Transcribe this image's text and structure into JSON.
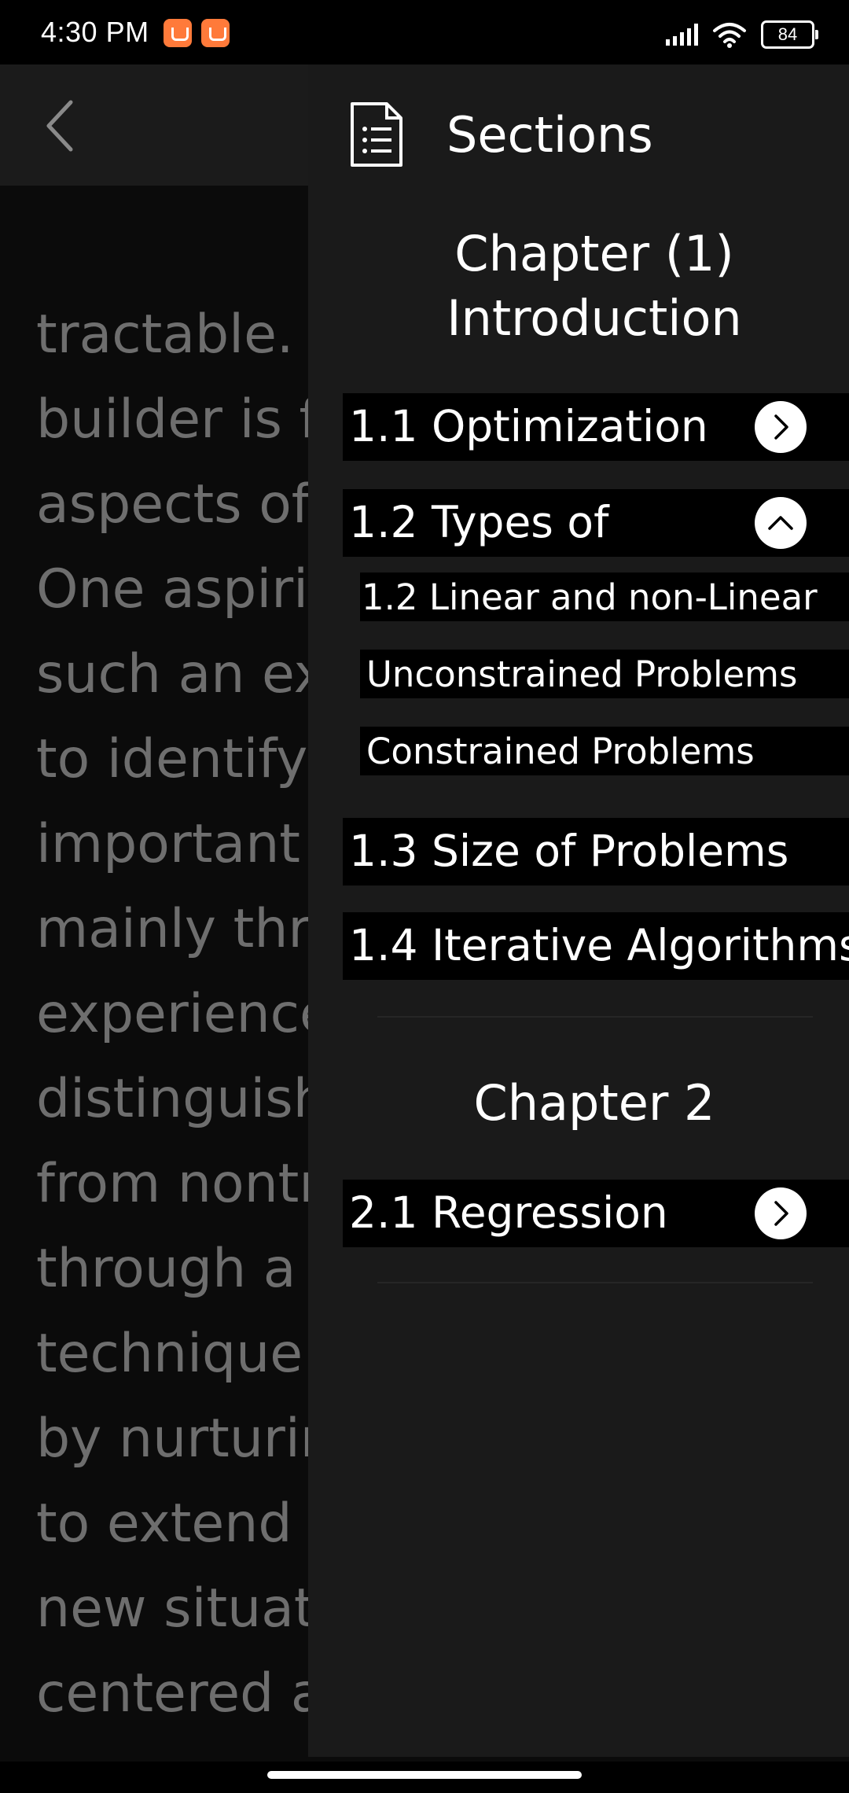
{
  "status_bar": {
    "time": "4:30 PM",
    "battery": "84",
    "icons": [
      "notification-app-icon",
      "notification-app-icon",
      "signal-icon",
      "wifi-icon",
      "battery-icon"
    ]
  },
  "reader": {
    "back_icon": "chevron-left-icon",
    "lines": [
      "tractable. T",
      "builder is fa",
      "aspects of t",
      "One aspirin",
      "such an exp",
      "to identify a",
      "important is",
      "mainly thro",
      "experience;",
      "distinguish t",
      "from nontra",
      "through a st",
      "technique a",
      "by nurturing",
      "to extend e",
      "new situatio",
      "centered ar"
    ]
  },
  "drawer": {
    "header_icon": "document-list-icon",
    "title": "Sections",
    "chapters": [
      {
        "title_line1": "Chapter (1)",
        "title_line2": "Introduction",
        "items": [
          {
            "label": "1.1 Optimization",
            "state": "collapsed"
          },
          {
            "label": "1.2 Types of",
            "state": "expanded",
            "subitems": [
              "1.2 Linear and non-Linear",
              "Unconstrained Problems",
              "Constrained Problems"
            ]
          },
          {
            "label": "1.3 Size of Problems"
          },
          {
            "label": "1.4 Iterative Algorithms"
          }
        ]
      },
      {
        "title_line1": "Chapter 2",
        "items": [
          {
            "label": "2.1 Regression",
            "state": "collapsed"
          }
        ]
      }
    ]
  },
  "colors": {
    "drawer_bg": "#1a1a1a",
    "row_bg": "#000000",
    "reader_text": "#6e6e6e",
    "notification_icon": "#ff7a3a"
  }
}
